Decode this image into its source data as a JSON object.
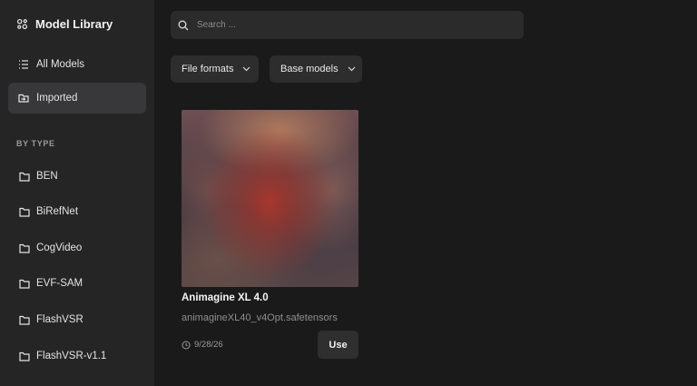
{
  "sidebar": {
    "title": "Model Library",
    "brand_icon": "models-icon",
    "nav": [
      {
        "label": "All Models",
        "icon": "list-icon"
      },
      {
        "label": "Imported",
        "icon": "folder-import-icon",
        "active": true
      }
    ],
    "section_label": "BY TYPE",
    "types": [
      "BEN",
      "BiRefNet",
      "CogVideo",
      "EVF-SAM",
      "FlashVSR",
      "FlashVSR-v1.1"
    ]
  },
  "search": {
    "placeholder": "Search ..."
  },
  "filters": {
    "file_formats": "File formats",
    "base_models": "Base models"
  },
  "card": {
    "title": "Animagine XL 4.0",
    "filename": "animagineXL40_v4Opt.safetensors",
    "date": "9/28/26",
    "use_label": "Use"
  },
  "colors": {
    "background": "#1a1a1a",
    "sidebar": "#252526",
    "active": "#38383a"
  }
}
